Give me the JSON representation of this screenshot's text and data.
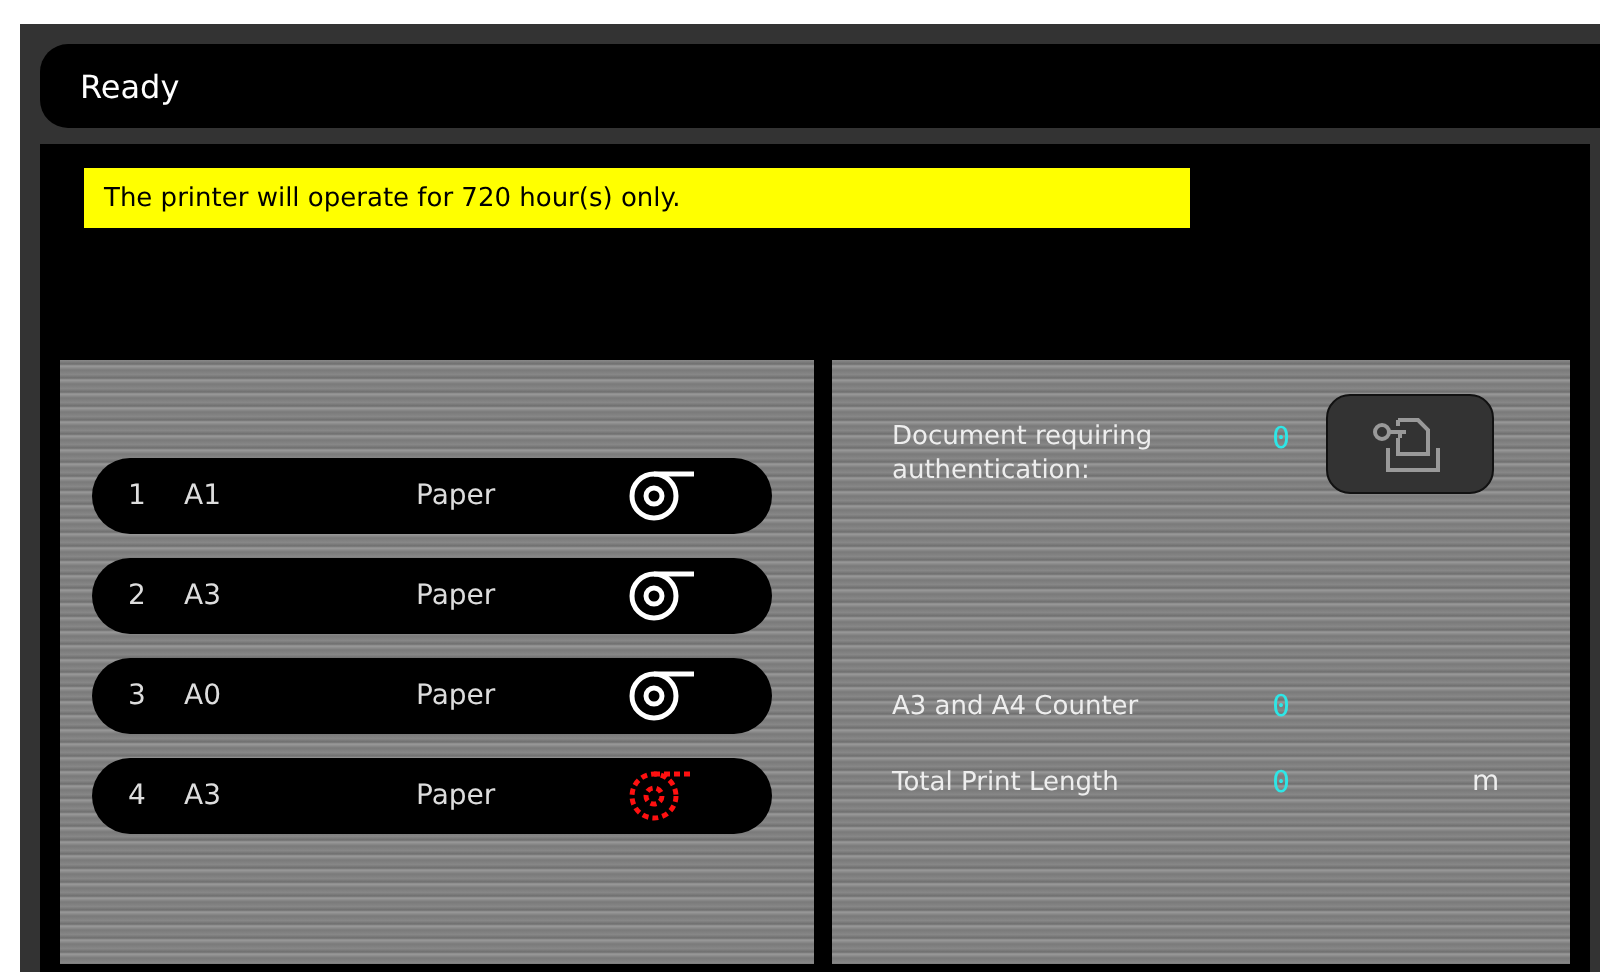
{
  "status_bar": {
    "title": "Ready"
  },
  "notice": {
    "text": "The printer will operate for 720 hour(s) only."
  },
  "rolls": [
    {
      "number": "1",
      "size": "A1",
      "media": "Paper",
      "empty": false
    },
    {
      "number": "2",
      "size": "A3",
      "media": "Paper",
      "empty": false
    },
    {
      "number": "3",
      "size": "A0",
      "media": "Paper",
      "empty": false
    },
    {
      "number": "4",
      "size": "A3",
      "media": "Paper",
      "empty": true
    }
  ],
  "auth": {
    "label": "Document requiring authentication:",
    "value": "0"
  },
  "counters": [
    {
      "label": "A3 and A4 Counter",
      "value": "0"
    },
    {
      "label": "Total Print Length",
      "value": "0",
      "unit": "m"
    }
  ]
}
